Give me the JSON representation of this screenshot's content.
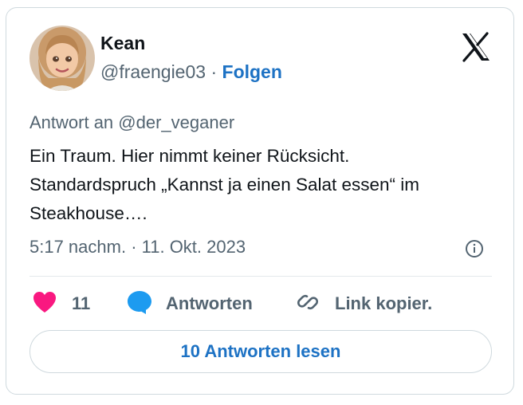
{
  "author": {
    "name": "Kean",
    "handle": "@fraengie03",
    "separator": "·",
    "follow_label": "Folgen"
  },
  "logo_icon": "x-logo-icon",
  "reply_to": "Antwort an @der_veganer",
  "tweet": {
    "text": "Ein Traum. Hier nimmt keiner Rücksicht.\nStandardspruch „Kannst ja einen Salat essen“  im\nSteakhouse…."
  },
  "timestamp": "5:17 nachm. · 11. Okt. 2023",
  "actions": {
    "like_count": "11",
    "reply_label": "Antworten",
    "copy_link_label": "Link kopier."
  },
  "read_replies_label": "10 Antworten lesen",
  "colors": {
    "like": "#f91880",
    "reply": "#1d9bf0",
    "link_blue": "#1d72c4",
    "muted": "#536471",
    "text": "#0f1419",
    "border": "#cfd9de"
  }
}
